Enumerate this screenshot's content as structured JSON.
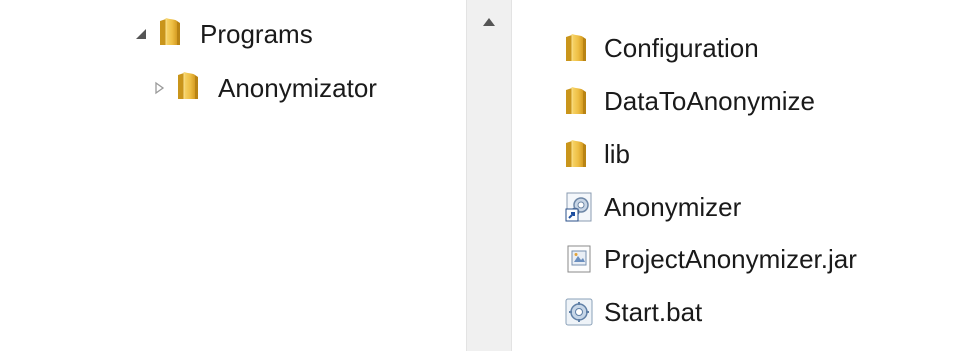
{
  "nav_tree": {
    "items": [
      {
        "label": "Programs",
        "icon": "folder-icon",
        "expanded": true
      },
      {
        "label": "Anonymizator",
        "icon": "folder-icon",
        "expanded": false
      }
    ]
  },
  "file_list": {
    "items": [
      {
        "name": "Configuration",
        "icon": "folder-icon"
      },
      {
        "name": "DataToAnonymize",
        "icon": "folder-icon"
      },
      {
        "name": "lib",
        "icon": "folder-icon"
      },
      {
        "name": "Anonymizer",
        "icon": "shortcut-icon"
      },
      {
        "name": "ProjectAnonymizer.jar",
        "icon": "jar-file-icon"
      },
      {
        "name": "Start.bat",
        "icon": "batch-file-icon"
      }
    ]
  },
  "colors": {
    "folder": "#e8b830",
    "folder_dark": "#c9951b",
    "text": "#1a1a1a",
    "scrollbar_bg": "#f0f0f0"
  }
}
